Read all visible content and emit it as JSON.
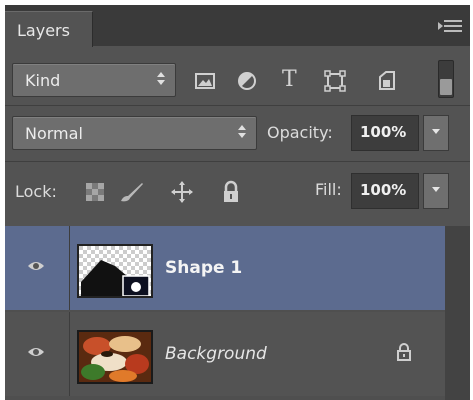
{
  "panel": {
    "tab_label": "Layers",
    "menu_icon": "panel-menu-icon"
  },
  "filter": {
    "kind_label": "Kind",
    "icons": [
      "pixel-layer-filter-icon",
      "adjustment-layer-filter-icon",
      "type-layer-filter-icon",
      "shape-layer-filter-icon",
      "smart-object-filter-icon"
    ],
    "type_glyph": "T",
    "toggle_state": "on"
  },
  "blend": {
    "mode": "Normal",
    "opacity_label": "Opacity:",
    "opacity_value": "100%"
  },
  "lock": {
    "label": "Lock:",
    "icons": [
      "lock-transparent-pixels-icon",
      "lock-image-pixels-icon",
      "lock-position-icon",
      "lock-all-icon"
    ],
    "fill_label": "Fill:",
    "fill_value": "100%"
  },
  "layers": [
    {
      "name": "Shape 1",
      "visible": true,
      "selected": true,
      "thumbnail": "shape-thumbnail-icon"
    },
    {
      "name": "Background",
      "visible": true,
      "selected": false,
      "locked": true,
      "thumbnail": "photo-thumbnail-icon"
    }
  ],
  "colors": {
    "panel_bg": "#535353",
    "selected_row": "#5c6b8f"
  }
}
